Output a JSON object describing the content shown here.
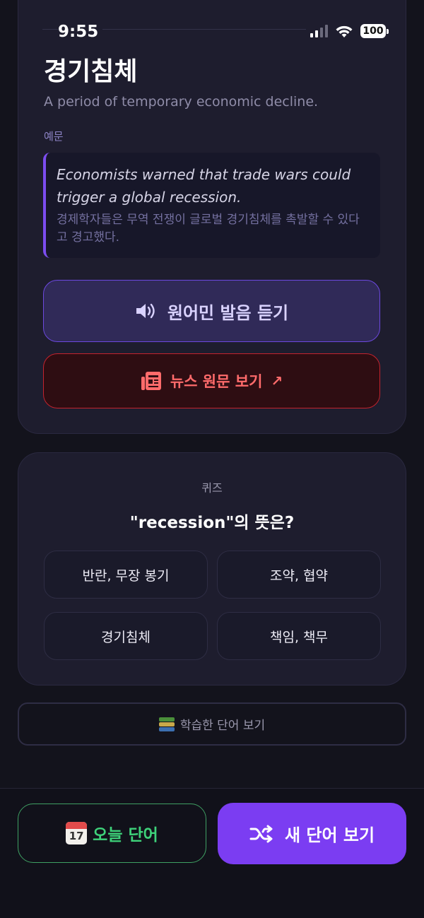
{
  "status_bar": {
    "time": "9:55",
    "battery": "100",
    "icons": [
      "signal-icon",
      "wifi-icon",
      "battery-icon"
    ]
  },
  "word": {
    "title": "경기침체",
    "definition": "A period of temporary economic decline.",
    "example_label": "예문",
    "example_en": "Economists warned that trade wars could trigger a global recession.",
    "example_ko": "경제학자들은 무역 전쟁이 글로벌 경기침체를 촉발할 수 있다고 경고했다."
  },
  "actions": {
    "pronunciation_label": "원어민 발음 듣기",
    "pronunciation_icon": "speaker-icon",
    "news_label": "뉴스 원문 보기",
    "news_icon": "newspaper-icon",
    "news_arrow": "↗"
  },
  "quiz": {
    "label": "퀴즈",
    "question": "\"recession\"의 뜻은?",
    "options": [
      "반란, 무장 봉기",
      "조약, 협약",
      "경기침체",
      "책임, 책무"
    ]
  },
  "learned_button": {
    "label": "학습한 단어 보기",
    "icon": "books-icon"
  },
  "bottom_bar": {
    "today_label": "오늘 단어",
    "today_icon": "calendar-icon",
    "calendar_day": "17",
    "new_label": "새 단어 보기",
    "new_icon": "shuffle-icon"
  },
  "colors": {
    "background": "#13131c",
    "card": "#1e1d2e",
    "accent_purple": "#7b3df2",
    "news_red": "#ff6b6b",
    "today_green": "#3ed27a"
  }
}
